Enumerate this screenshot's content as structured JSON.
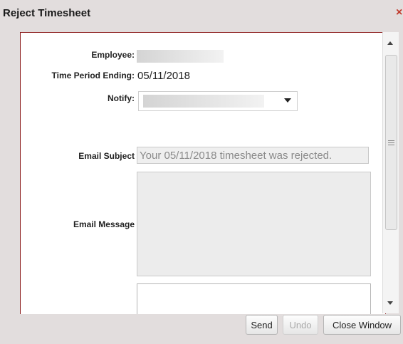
{
  "dialog": {
    "title": "Reject Timesheet",
    "close_glyph": "×"
  },
  "form": {
    "employee_label": "Employee:",
    "period_label": "Time Period Ending:",
    "period_value": "05/11/2018",
    "notify_label": "Notify:",
    "subject_label": "Email Subject",
    "subject_value": "Your 05/11/2018 timesheet was rejected.",
    "message_label": "Email Message"
  },
  "buttons": {
    "send": "Send",
    "undo": "Undo",
    "close_window": "Close Window"
  },
  "colors": {
    "panel_border": "#8b1a1a",
    "close_icon": "#c0392b"
  }
}
